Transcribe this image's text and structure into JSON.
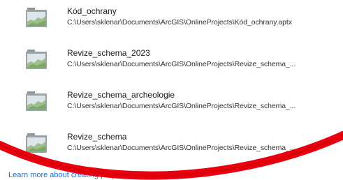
{
  "templates": [
    {
      "name": "Kód_ochrany",
      "path": "C:\\Users\\sklenar\\Documents\\ArcGIS\\OnlineProjects\\Kód_ochrany.aptx"
    },
    {
      "name": "Revize_schema_2023",
      "path": "C:\\Users\\sklenar\\Documents\\ArcGIS\\OnlineProjects\\Revize_schema_..."
    },
    {
      "name": "Revize_schema_archeologie",
      "path": "C:\\Users\\sklenar\\Documents\\ArcGIS\\OnlineProjects\\Revize_schema_..."
    },
    {
      "name": "Revize_schema",
      "path": "C:\\Users\\sklenar\\Documents\\ArcGIS\\OnlineProjects\\Revize_schema_..."
    }
  ],
  "learn_more_link": "Learn more about creating project templates",
  "icons": {
    "template": "project-template-icon"
  },
  "colors": {
    "link": "#1f6fd1",
    "annotation": "#e8000f"
  }
}
